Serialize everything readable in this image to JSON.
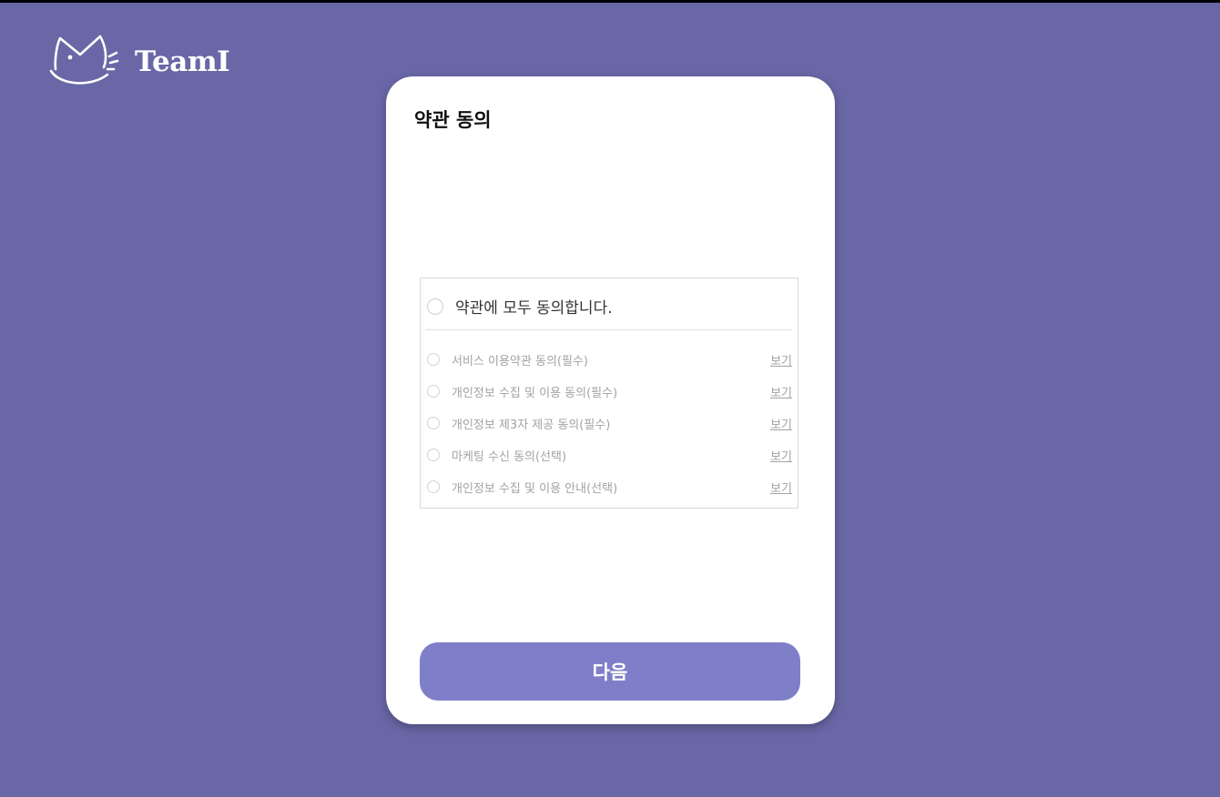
{
  "brand": {
    "name": "TeamI"
  },
  "card": {
    "title": "약관 동의",
    "agree_all_label": "약관에 모두 동의합니다.",
    "items": [
      {
        "label": "서비스 이용약관 동의(필수)",
        "link": "보기"
      },
      {
        "label": "개인정보 수집 및 이용 동의(필수)",
        "link": "보기"
      },
      {
        "label": "개인정보 제3자 제공 동의(필수)",
        "link": "보기"
      },
      {
        "label": "마케팅 수신 동의(선택)",
        "link": "보기"
      },
      {
        "label": "개인정보 수집 및 이용 안내(선택)",
        "link": "보기"
      }
    ],
    "next_button": "다음"
  },
  "colors": {
    "background": "#6a67a7",
    "button": "#7f7fc9",
    "card": "#ffffff"
  },
  "icons": {
    "logo": "cat-face-logo-icon",
    "radio": "radio-unchecked-icon"
  }
}
